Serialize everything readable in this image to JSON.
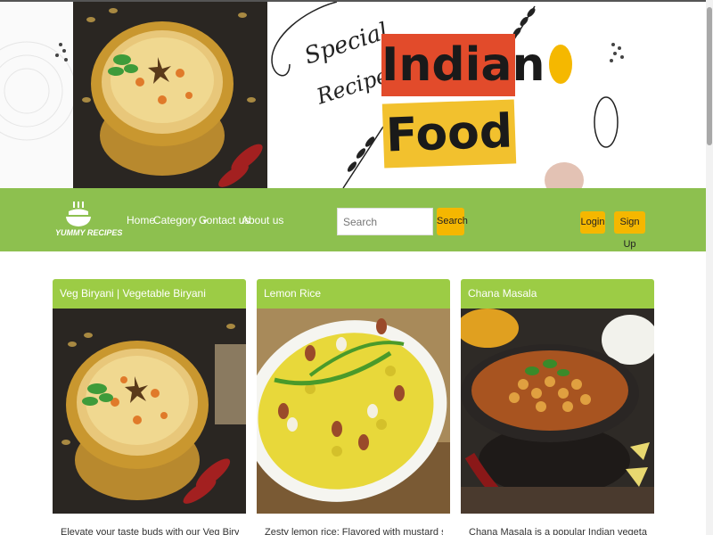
{
  "banner": {
    "special": "Special",
    "recipes": "Recipes",
    "indian": "Indian",
    "food": "Food"
  },
  "navbar": {
    "brand": "YUMMY RECIPES",
    "links": [
      "Home",
      "Category",
      "Contact us",
      "About us"
    ],
    "search_placeholder": "Search",
    "search_button": "Search",
    "login": "Login",
    "signup": "Sign Up"
  },
  "cards": [
    {
      "title": "Veg Biryani | Vegetable Biryani",
      "text": "Elevate your taste buds with our Veg Biryani— a"
    },
    {
      "title": "Lemon Rice",
      "text": "Zesty lemon rice: Flavored with mustard seeds, curry"
    },
    {
      "title": "Chana Masala",
      "text": "Chana Masala is a popular Indian vegetarian dish"
    }
  ],
  "colors": {
    "navbar": "#8dc04f",
    "card_header": "#9ccc45",
    "button": "#f5b700",
    "indian_tag": "#e24b2b",
    "food_tag": "#f2c12e"
  }
}
